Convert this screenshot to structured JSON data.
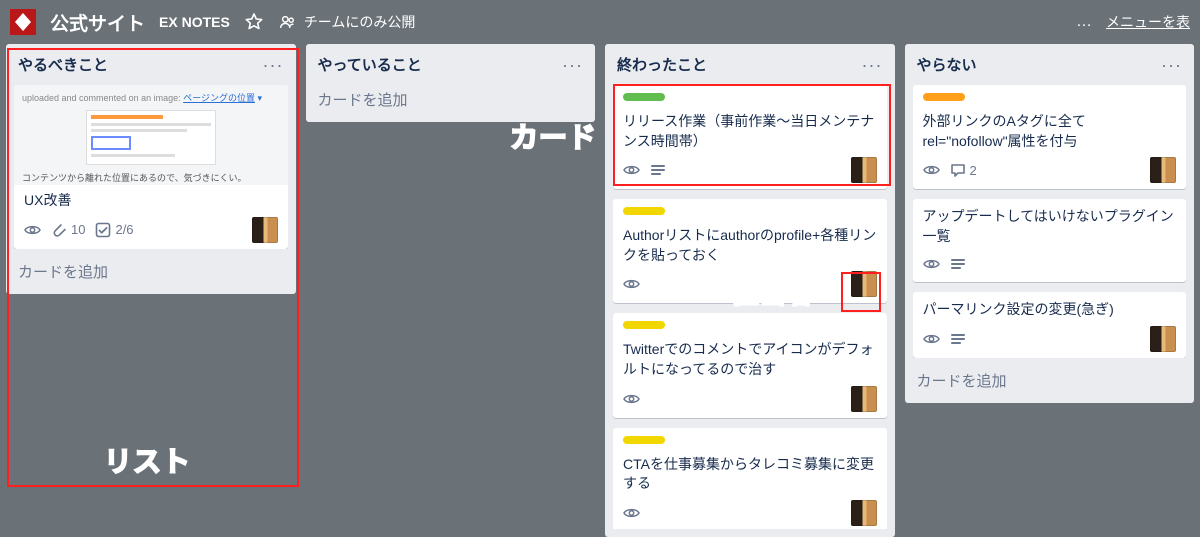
{
  "header": {
    "board_title": "公式サイト",
    "ex_notes": "EX NOTES",
    "visibility": "チームにのみ公開",
    "menu": "メニューを表",
    "dots": "…"
  },
  "add_card_label": "カードを追加",
  "lists": {
    "todo": {
      "title": "やるべきこと"
    },
    "doing": {
      "title": "やっていること"
    },
    "done": {
      "title": "終わったこと"
    },
    "never": {
      "title": "やらない"
    }
  },
  "cards": {
    "ux": {
      "title": "UX改善",
      "attachments": "10",
      "checklist": "2/6",
      "cover_head": "uploaded and commented on an image:",
      "cover_link": "ページングの位置",
      "cover_foot": "コンテンツから離れた位置にあるので、気づきにくい。"
    },
    "release": {
      "title": "リリース作業（事前作業〜当日メンテナンス時間帯）"
    },
    "author": {
      "title": "Authorリストにauthorのprofile+各種リンクを貼っておく"
    },
    "twitter": {
      "title": "Twitterでのコメントでアイコンがデフォルトになってるので治す"
    },
    "cta": {
      "title": "CTAを仕事募集からタレコミ募集に変更する"
    },
    "nofollow": {
      "title": "外部リンクのAタグに全てrel=\"nofollow\"属性を付与",
      "comments": "2"
    },
    "plugins": {
      "title": "アップデートしてはいけないプラグイン一覧"
    },
    "permalink": {
      "title": "パーマリンク設定の変更(急ぎ)"
    }
  },
  "annotations": {
    "card": "カード",
    "assignee": "担当者",
    "list": "リスト"
  }
}
